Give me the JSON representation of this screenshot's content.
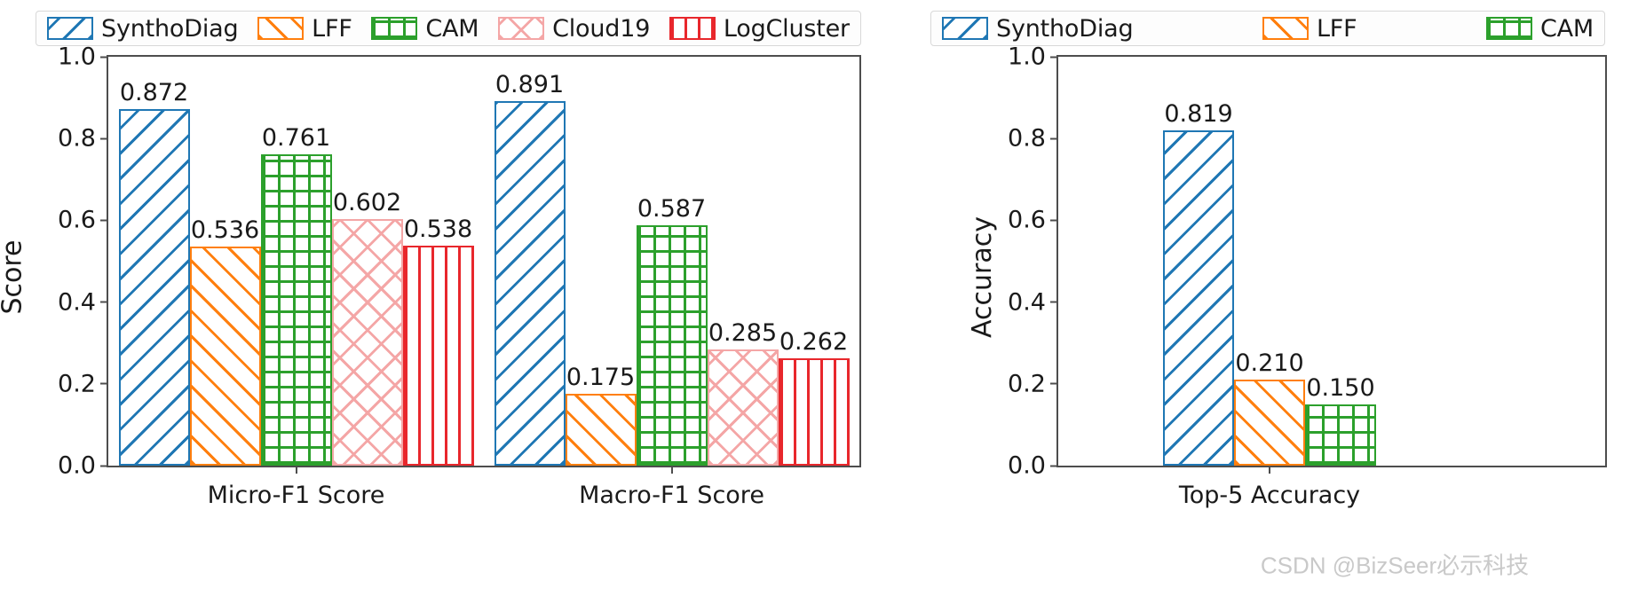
{
  "chart_data": [
    {
      "type": "bar",
      "title": "",
      "panel": "left",
      "xlabel": "",
      "ylabel": "Score",
      "ylim": [
        0.0,
        1.0
      ],
      "yticks": [
        "0.0",
        "0.2",
        "0.4",
        "0.6",
        "0.8",
        "1.0"
      ],
      "ytick_values": [
        0.0,
        0.2,
        0.4,
        0.6,
        0.8,
        1.0
      ],
      "grid": false,
      "legend_position": "above-axes",
      "categories": [
        "Micro-F1 Score",
        "Macro-F1 Score"
      ],
      "series": [
        {
          "name": "SynthoDiag",
          "values": [
            0.872,
            0.891
          ],
          "color": "#1f77b4",
          "hatch": "backslash-diagonal"
        },
        {
          "name": "LFF",
          "values": [
            0.536,
            0.175
          ],
          "color": "#ff7f0e",
          "hatch": "forward-diagonal"
        },
        {
          "name": "CAM",
          "values": [
            0.761,
            0.587
          ],
          "color": "#2ca02c",
          "hatch": "grid"
        },
        {
          "name": "Cloud19",
          "values": [
            0.602,
            0.285
          ],
          "color": "#f4a6a6",
          "hatch": "diagonal-cross"
        },
        {
          "name": "LogCluster",
          "values": [
            0.538,
            0.262
          ],
          "color": "#e8272c",
          "hatch": "vertical"
        }
      ],
      "value_labels": [
        [
          "0.872",
          "0.536",
          "0.761",
          "0.602",
          "0.538"
        ],
        [
          "0.891",
          "0.175",
          "0.587",
          "0.285",
          "0.262"
        ]
      ]
    },
    {
      "type": "bar",
      "title": "",
      "panel": "right",
      "xlabel": "",
      "ylabel": "Accuracy",
      "ylim": [
        0.0,
        1.0
      ],
      "yticks": [
        "0.0",
        "0.2",
        "0.4",
        "0.6",
        "0.8",
        "1.0"
      ],
      "ytick_values": [
        0.0,
        0.2,
        0.4,
        0.6,
        0.8,
        1.0
      ],
      "grid": false,
      "legend_position": "above-axes",
      "categories": [
        "Top-5 Accuracy"
      ],
      "series": [
        {
          "name": "SynthoDiag",
          "values": [
            0.819
          ],
          "color": "#1f77b4",
          "hatch": "backslash-diagonal"
        },
        {
          "name": "LFF",
          "values": [
            0.21
          ],
          "color": "#ff7f0e",
          "hatch": "forward-diagonal"
        },
        {
          "name": "CAM",
          "values": [
            0.15
          ],
          "color": "#2ca02c",
          "hatch": "grid"
        }
      ],
      "value_labels": [
        [
          "0.819",
          "0.210",
          "0.150"
        ]
      ]
    }
  ],
  "left_panel": {
    "legend": {
      "items": [
        {
          "label": "SynthoDiag",
          "color": "#1f77b4",
          "hatch": "backslash-diagonal"
        },
        {
          "label": "LFF",
          "color": "#ff7f0e",
          "hatch": "forward-diagonal"
        },
        {
          "label": "CAM",
          "color": "#2ca02c",
          "hatch": "grid"
        },
        {
          "label": "Cloud19",
          "color": "#f4a6a6",
          "hatch": "diagonal-cross"
        },
        {
          "label": "LogCluster",
          "color": "#e8272c",
          "hatch": "vertical"
        }
      ]
    },
    "ylabel": "Score",
    "yticks": [
      "0.0",
      "0.2",
      "0.4",
      "0.6",
      "0.8",
      "1.0"
    ],
    "xticks": [
      "Micro-F1 Score",
      "Macro-F1 Score"
    ]
  },
  "right_panel": {
    "legend": {
      "items": [
        {
          "label": "SynthoDiag",
          "color": "#1f77b4",
          "hatch": "backslash-diagonal"
        },
        {
          "label": "LFF",
          "color": "#ff7f0e",
          "hatch": "forward-diagonal"
        },
        {
          "label": "CAM",
          "color": "#2ca02c",
          "hatch": "grid"
        }
      ]
    },
    "ylabel": "Accuracy",
    "yticks": [
      "0.0",
      "0.2",
      "0.4",
      "0.6",
      "0.8",
      "1.0"
    ],
    "xticks": [
      "Top-5 Accuracy"
    ]
  },
  "watermark": {
    "text": "CSDN @BizSeer必示科技",
    "color": "#c9c9c9"
  }
}
